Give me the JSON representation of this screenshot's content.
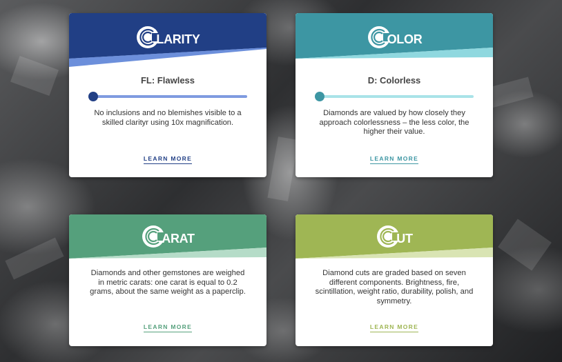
{
  "cards": {
    "clarity": {
      "title_initial": "C",
      "title_rest": "LARITY",
      "grade": "FL: Flawless",
      "slider_value": 0,
      "description": "No inclusions and no blemishes visible to a skilled clarityr using 10x magnification.",
      "link": "LEARN MORE",
      "colors": {
        "primary": "#213f85",
        "accent": "#6c8fdb",
        "track": "#7f9be0",
        "knob": "#213f85",
        "link": "#213f85"
      }
    },
    "color": {
      "title_initial": "C",
      "title_rest": "OLOR",
      "grade": "D: Colorless",
      "slider_value": 0,
      "description": "Diamonds are valued by how closely they approach colorlessness – the less color, the higher their value.",
      "link": "LEARN MORE",
      "colors": {
        "primary": "#3d96a3",
        "accent": "#8fd8df",
        "track": "#a9e3e8",
        "knob": "#3d96a3",
        "link": "#3d96a3"
      }
    },
    "carat": {
      "title_initial": "C",
      "title_rest": "ARAT",
      "description": "Diamonds and other gemstones are weighed in metric carats: one carat is equal to 0.2 grams, about the same weight as a paperclip.",
      "link": "LEARN MORE",
      "colors": {
        "primary": "#55a07c",
        "accent": "#b5dcc8",
        "link": "#55a07c"
      }
    },
    "cut": {
      "title_initial": "C",
      "title_rest": "UT",
      "description": "Diamond cuts are graded based on seven different components. Brightness, fire, scintillation, weight ratio, durability, polish, and symmetry.",
      "link": "LEARN MORE",
      "colors": {
        "primary": "#9fb654",
        "accent": "#d9e4b3",
        "link": "#9fb654"
      }
    }
  },
  "icons": {
    "title_logo": "c-stripe-logo-icon"
  }
}
